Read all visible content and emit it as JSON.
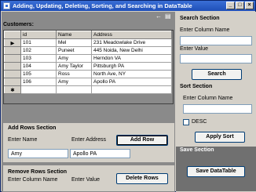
{
  "window": {
    "title": "Adding, Updating, Deleting, Sorting, and Searching in DataTable",
    "minimize": "_",
    "maximize": "□",
    "close": "×"
  },
  "toolbar": {
    "arrow_icon": "←",
    "grid_icon": "▤"
  },
  "customers_label": "Customers:",
  "grid": {
    "columns": [
      "id",
      "Name",
      "Address"
    ],
    "current_row_marker": "▶",
    "new_row_marker": "✱",
    "rows": [
      {
        "id": "101",
        "name": "Mel",
        "address": "231 Meadowlake Drive"
      },
      {
        "id": "102",
        "name": "Puneet",
        "address": "445 Noida, New Delhi"
      },
      {
        "id": "103",
        "name": "Amy",
        "address": "Herndon VA"
      },
      {
        "id": "104",
        "name": "Amy Taylor",
        "address": "Pittsburgh PA"
      },
      {
        "id": "105",
        "name": "Ross",
        "address": "North Ave, NY"
      },
      {
        "id": "106",
        "name": "Amy",
        "address": "Apollo PA"
      }
    ]
  },
  "add_rows": {
    "title": "Add Rows Section",
    "name_label": "Enter Name",
    "address_label": "Enter Address",
    "name_value": "Amy",
    "address_value": "Apollo PA",
    "button": "Add Row"
  },
  "remove_rows": {
    "title": "Remove Rows Section",
    "column_label": "Enter Column Name",
    "value_label": "Enter Value",
    "button": "Delete Rows"
  },
  "search": {
    "title": "Search Section",
    "column_label": "Enter Column Name",
    "value_label": "Enter Value",
    "column_value": "",
    "value_value": "",
    "button": "Search"
  },
  "sort": {
    "title": "Sort Section",
    "column_label": "Enter Column Name",
    "column_value": "",
    "desc_label": "DESC",
    "desc_checked": false,
    "button": "Apply Sort"
  },
  "save": {
    "title": "Save Section",
    "button": "Save DataTable"
  }
}
